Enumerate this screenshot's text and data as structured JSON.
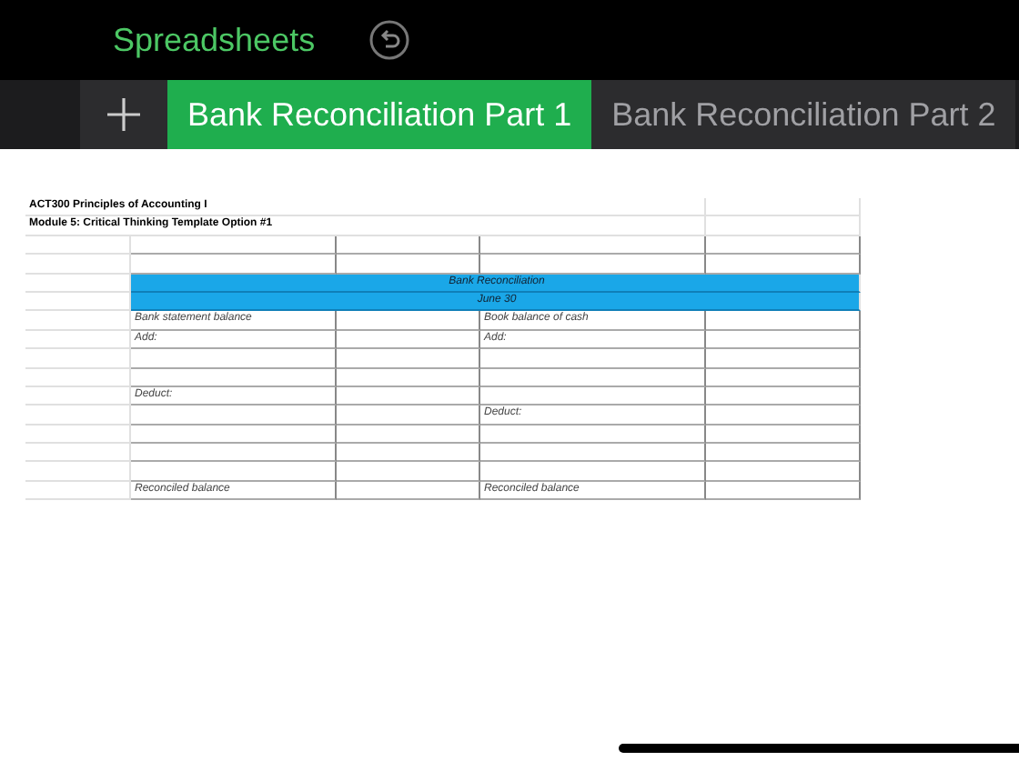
{
  "app_bar": {
    "title": "Spreadsheets"
  },
  "tabs": [
    {
      "label": "Bank Reconciliation Part 1",
      "selected": true
    },
    {
      "label": "Bank Reconciliation Part 2",
      "selected": false
    }
  ],
  "sheet": {
    "rows": [
      {
        "kind": "title",
        "text": "ACT300 Principles of Accounting I"
      },
      {
        "kind": "title",
        "text": "Module 5: Critical Thinking Template Option #1"
      },
      {
        "kind": "pair",
        "left": "",
        "right": ""
      },
      {
        "kind": "pair",
        "left": "",
        "right": ""
      },
      {
        "kind": "banner",
        "text": "Bank Reconciliation"
      },
      {
        "kind": "banner",
        "text": "June 30"
      },
      {
        "kind": "pair",
        "left": "Bank statement balance",
        "right": "Book balance of cash"
      },
      {
        "kind": "pair",
        "left": "Add:",
        "right": "Add:"
      },
      {
        "kind": "pair",
        "left": "",
        "right": ""
      },
      {
        "kind": "pair",
        "left": "",
        "right": ""
      },
      {
        "kind": "pair",
        "left": "Deduct:",
        "right": ""
      },
      {
        "kind": "pair",
        "left": "",
        "right": "Deduct:"
      },
      {
        "kind": "pair",
        "left": "",
        "right": ""
      },
      {
        "kind": "pair",
        "left": "",
        "right": ""
      },
      {
        "kind": "pair",
        "left": "",
        "right": ""
      },
      {
        "kind": "pair",
        "left": "Reconciled balance",
        "right": "Reconciled balance"
      }
    ]
  }
}
